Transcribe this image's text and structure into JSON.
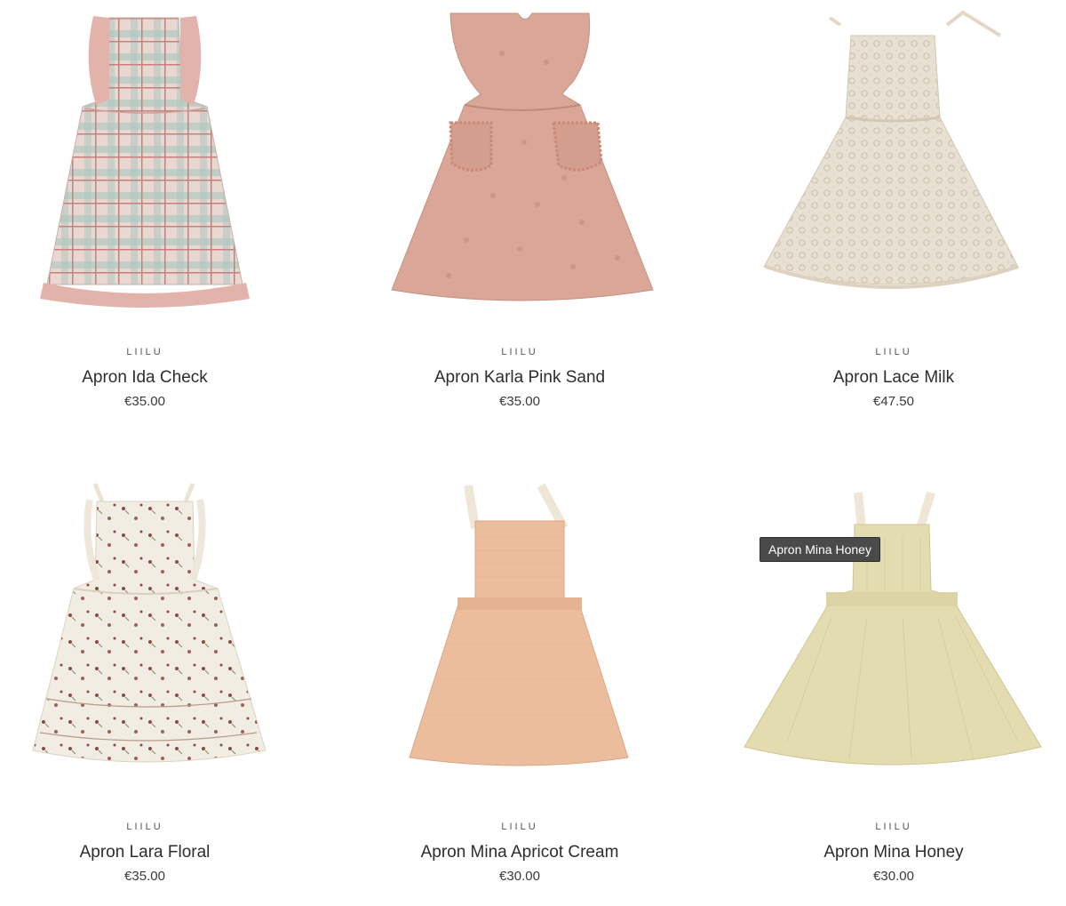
{
  "products": [
    {
      "brand": "LIILU",
      "title": "Apron Ida Check",
      "price": "€35.00",
      "image_icon": "plaid-pinafore-dress-image"
    },
    {
      "brand": "LIILU",
      "title": "Apron Karla Pink Sand",
      "price": "€35.00",
      "image_icon": "pink-pinafore-dress-image"
    },
    {
      "brand": "LIILU",
      "title": "Apron Lace Milk",
      "price": "€47.50",
      "image_icon": "lace-apron-image"
    },
    {
      "brand": "LIILU",
      "title": "Apron Lara Floral",
      "price": "€35.00",
      "image_icon": "floral-apron-dress-image"
    },
    {
      "brand": "LIILU",
      "title": "Apron Mina Apricot Cream",
      "price": "€30.00",
      "image_icon": "apricot-apron-dress-image"
    },
    {
      "brand": "LIILU",
      "title": "Apron Mina Honey",
      "price": "€30.00",
      "image_icon": "honey-apron-dress-image"
    }
  ],
  "tooltip": {
    "text": "Apron Mina Honey"
  },
  "colors": {
    "plaid_base": "#e8d6d0",
    "plaid_green": "#a8c4bc",
    "plaid_red": "#c98b86",
    "pink_sand": "#d9a697",
    "lace_milk": "#e6ddcf",
    "floral_base": "#f1ece2",
    "floral_dot": "#8a4a44",
    "apricot": "#ecbd9c",
    "honey": "#e3dcb0",
    "strap_cream": "#efe7dc"
  }
}
